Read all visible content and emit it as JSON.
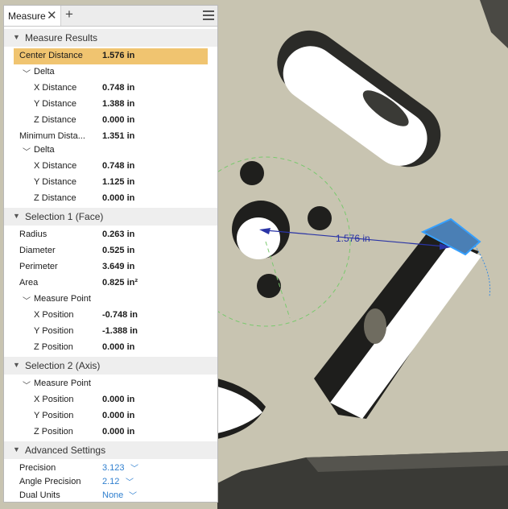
{
  "tab": {
    "label": "Measure",
    "close": "✕",
    "add": "+"
  },
  "sections": {
    "results": "Measure Results",
    "sel1": "Selection 1 (Face)",
    "sel2": "Selection 2 (Axis)",
    "adv": "Advanced Settings"
  },
  "results": {
    "center_label": "Center Distance",
    "center_value": "1.576 in",
    "delta1": "Delta",
    "dx1_label": "X Distance",
    "dx1_value": "0.748 in",
    "dy1_label": "Y Distance",
    "dy1_value": "1.388 in",
    "dz1_label": "Z Distance",
    "dz1_value": "0.000 in",
    "min_label": "Minimum Dista...",
    "min_value": "1.351 in",
    "delta2": "Delta",
    "dx2_label": "X Distance",
    "dx2_value": "0.748 in",
    "dy2_label": "Y Distance",
    "dy2_value": "1.125 in",
    "dz2_label": "Z Distance",
    "dz2_value": "0.000 in"
  },
  "sel1": {
    "radius_label": "Radius",
    "radius_value": "0.263 in",
    "diam_label": "Diameter",
    "diam_value": "0.525 in",
    "perim_label": "Perimeter",
    "perim_value": "3.649 in",
    "area_label": "Area",
    "area_value": "0.825 in²",
    "mp": "Measure Point",
    "x_label": "X Position",
    "x_value": "-0.748 in",
    "y_label": "Y Position",
    "y_value": "-1.388 in",
    "z_label": "Z Position",
    "z_value": "0.000 in"
  },
  "sel2": {
    "mp": "Measure Point",
    "x_label": "X Position",
    "x_value": "0.000 in",
    "y_label": "Y Position",
    "y_value": "0.000 in",
    "z_label": "Z Position",
    "z_value": "0.000 in"
  },
  "adv": {
    "precision_label": "Precision",
    "precision_value": "3.123",
    "angle_label": "Angle Precision",
    "angle_value": "2.12",
    "dual_label": "Dual Units",
    "dual_value": "None"
  },
  "viewport": {
    "dimension": "1.576 in"
  },
  "colors": {
    "highlight": "#f0c470",
    "link": "#2f7fcf",
    "dimension": "#2a34a6"
  },
  "icons": [
    "close-icon",
    "add-tab-icon",
    "hamburger-menu-icon",
    "collapse-arrow-icon",
    "chevron-down-icon"
  ]
}
